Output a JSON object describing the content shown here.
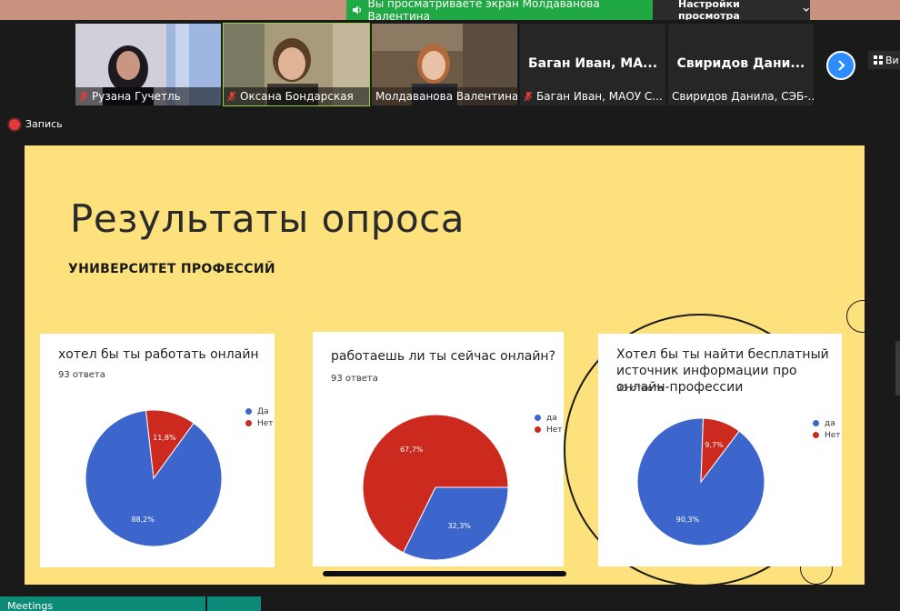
{
  "banner": {
    "sharing_text": "Вы просматриваете экран Молдаванова Валентина",
    "view_settings": "Настройки просмотра",
    "colors": {
      "banner": "#1fa843",
      "accent": "#2d8cff"
    }
  },
  "participants": [
    {
      "name": "Рузана Гучетль",
      "muted": true
    },
    {
      "name": "Оксана Бондарская",
      "muted": true
    },
    {
      "name": "Молдаванова Валентина",
      "muted": false
    },
    {
      "name": "Баган Иван, МАОУ С...",
      "big_name": "Баган Иван, МА...",
      "muted": true
    },
    {
      "name": "Свиридов Данила, СЭБ-...",
      "big_name": "Свиридов Дани...",
      "muted": false
    }
  ],
  "view_button": "Ви",
  "recording": {
    "label": "Запись"
  },
  "slide": {
    "title": "Результаты опроса",
    "subtitle": "УНИВЕРСИТЕТ ПРОФЕССИЙ"
  },
  "chart_data": [
    {
      "type": "pie",
      "title": "хотел бы ты работать онлайн",
      "responses": "93 ответа",
      "categories": [
        "Да",
        "Нет"
      ],
      "values": [
        88.2,
        11.8
      ],
      "labels": [
        "88,2%",
        "11,8%"
      ],
      "colors": [
        "#3d66cc",
        "#cc2a1f"
      ],
      "legend": "right"
    },
    {
      "type": "pie",
      "title": "работаешь ли ты сейчас онлайн?",
      "responses": "93 ответа",
      "categories": [
        "да",
        "Нет"
      ],
      "values": [
        32.3,
        67.7
      ],
      "labels": [
        "32,3%",
        "67,7%"
      ],
      "colors": [
        "#3d66cc",
        "#cc2a1f"
      ],
      "legend": "right"
    },
    {
      "type": "pie",
      "title": "Хотел бы ты найти бесплатный источник информации про онлайн-профессии",
      "responses": "93 ответа",
      "categories": [
        "да",
        "Нет"
      ],
      "values": [
        90.3,
        9.7
      ],
      "labels": [
        "90,3%",
        "9,7%"
      ],
      "colors": [
        "#3d66cc",
        "#cc2a1f"
      ],
      "legend": "right"
    }
  ],
  "taskbar": {
    "meetings_label": "Meetings"
  }
}
